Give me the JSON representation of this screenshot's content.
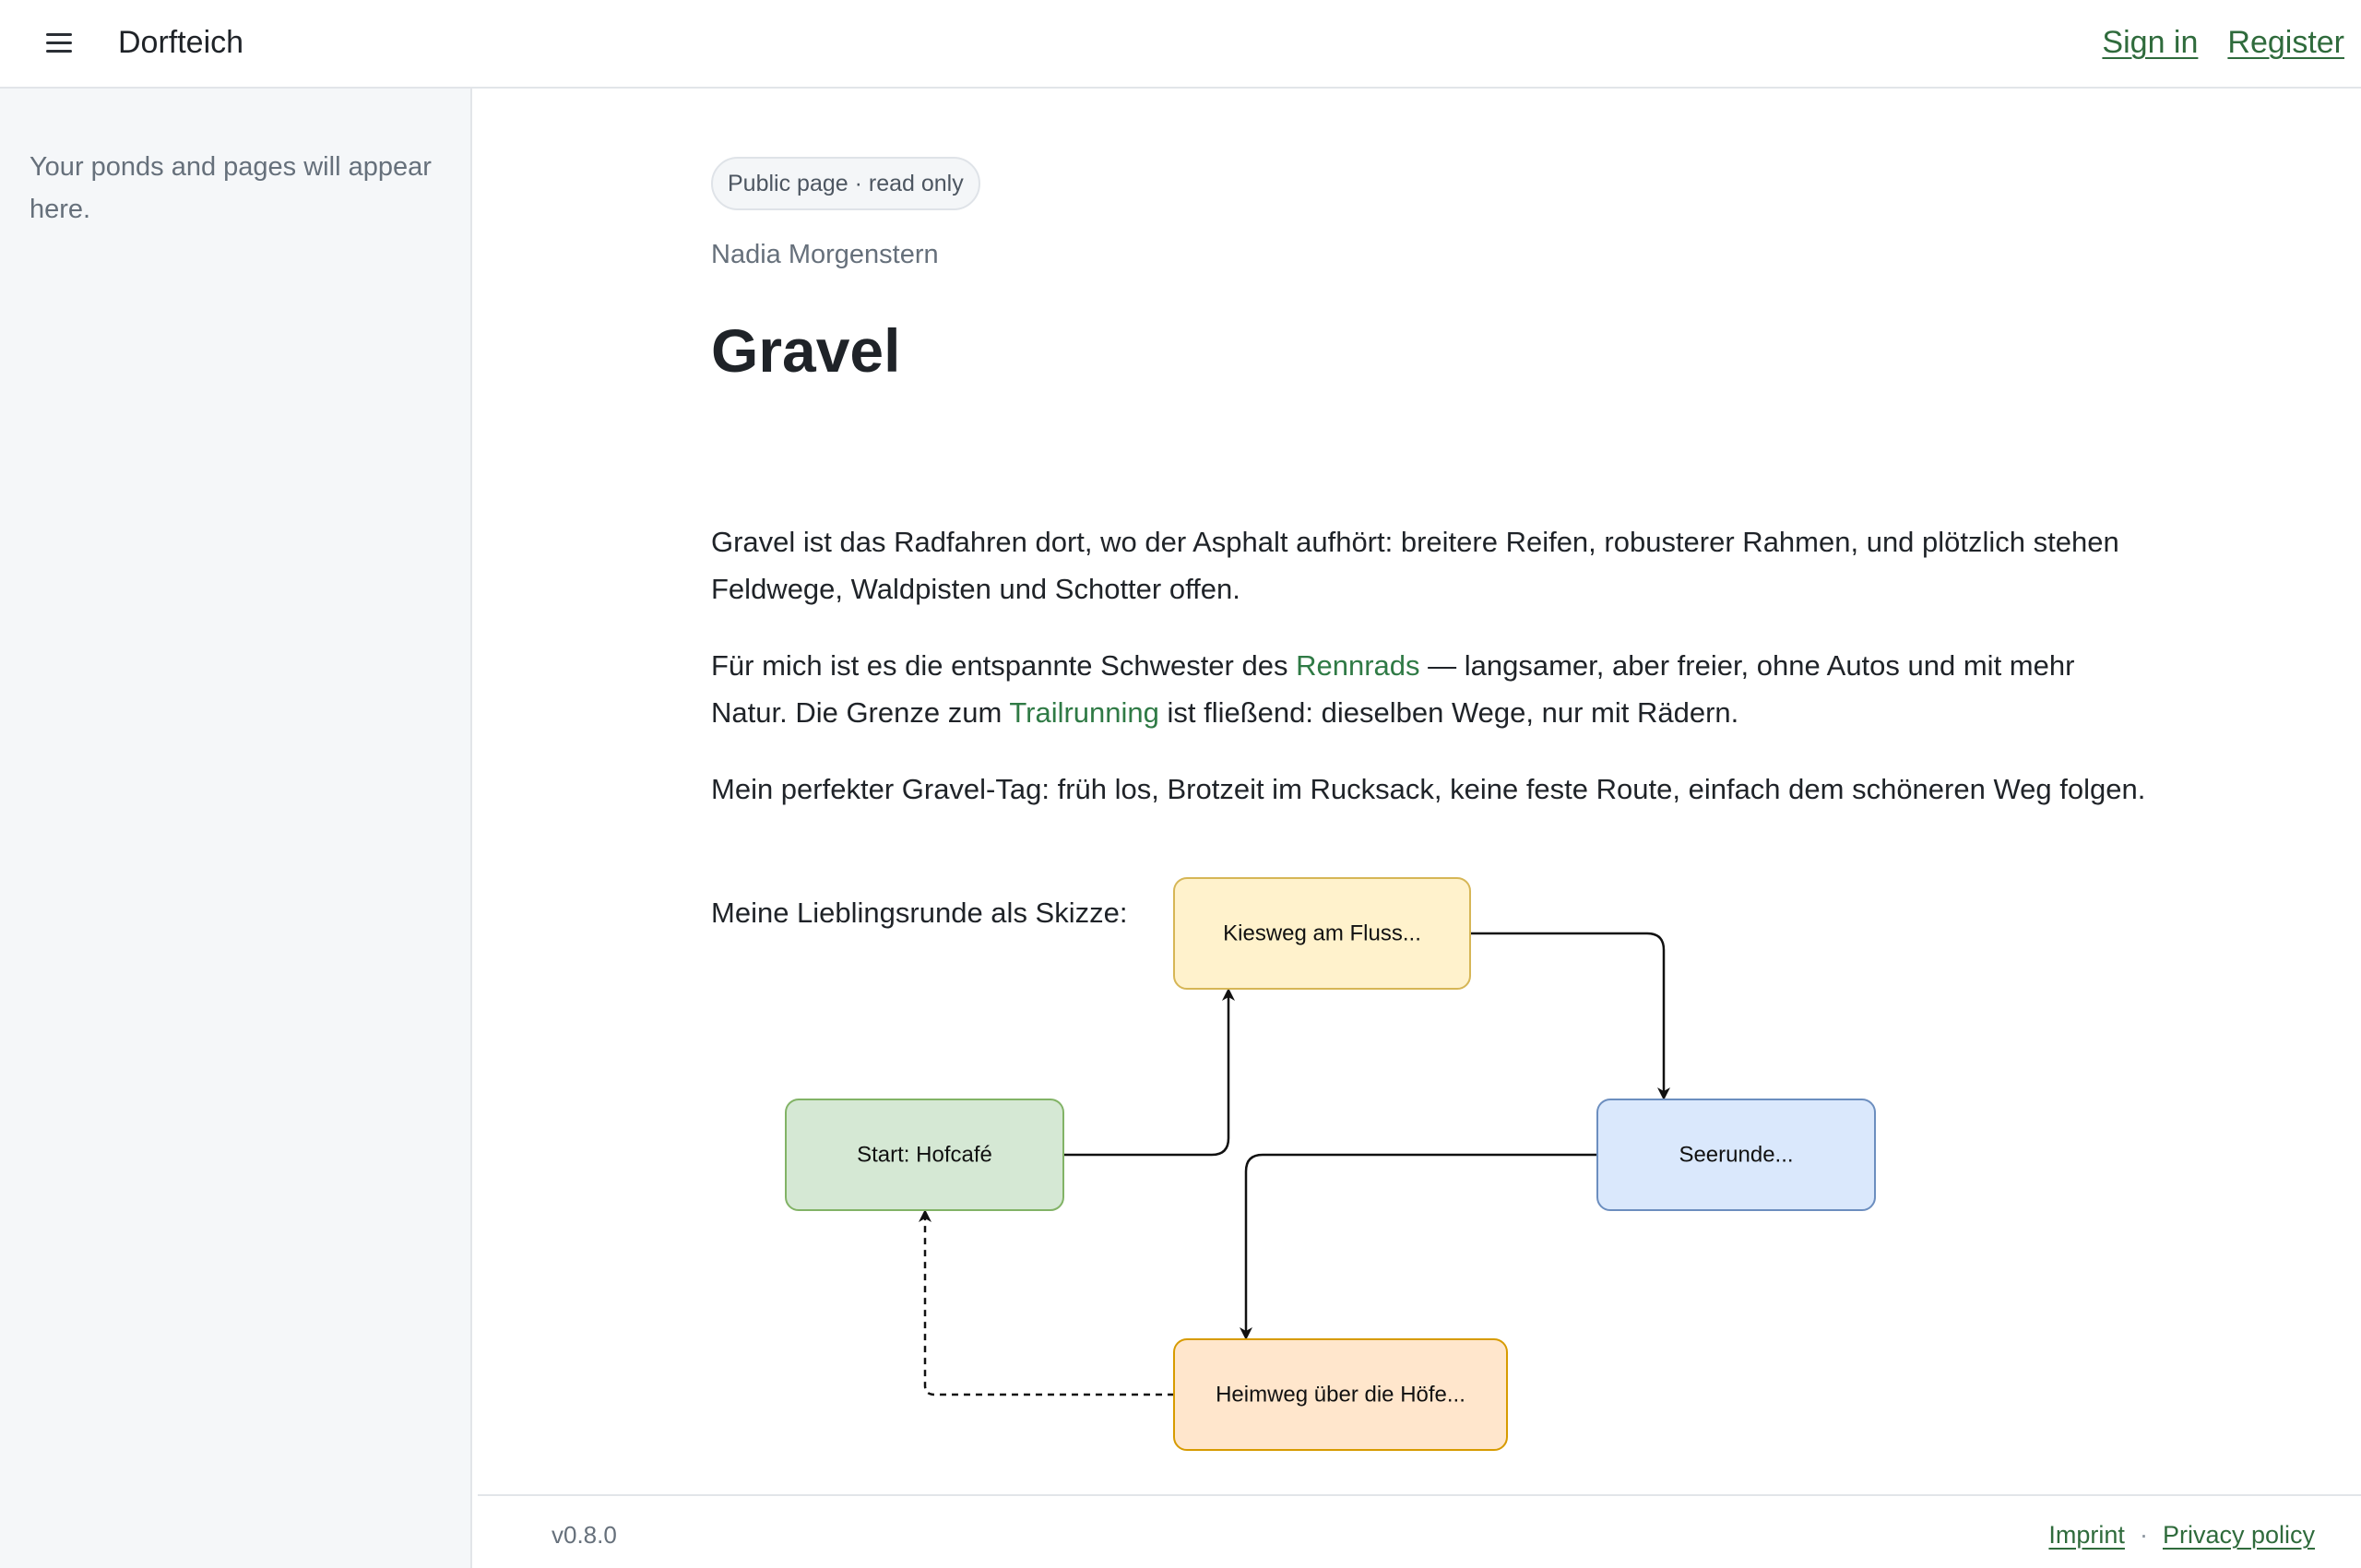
{
  "app": {
    "name": "Dorfteich",
    "menu_icon": "hamburger-menu-icon"
  },
  "header": {
    "sign_in_label": "Sign in",
    "register_label": "Register"
  },
  "sidebar": {
    "empty_text": "Your ponds and pages will appear here."
  },
  "page": {
    "badge": "Public page · read only",
    "author": "Nadia Morgenstern",
    "title": "Gravel",
    "paragraph_1": "Gravel ist das Radfahren dort, wo der Asphalt aufhört: breitere Reifen, robusterer Rahmen, und plötzlich stehen Feldwege, Waldpisten und Schotter offen.",
    "paragraph_2": {
      "before_link_1": "Für mich ist es die entspannte Schwester des ",
      "link_1": "Rennrads",
      "between_links": " — langsamer, aber freier, ohne Autos und mit mehr Natur. Die Grenze zum ",
      "link_2": "Trailrunning",
      "after_link_2": " ist fließend: dieselben Wege, nur mit Rädern."
    },
    "paragraph_3": "Mein perfekter Gravel-Tag: früh los, Brotzeit im Rucksack, keine feste Route, einfach dem schöneren Weg folgen.",
    "paragraph_4": "Meine Lieblingsrunde als Skizze:"
  },
  "diagram": {
    "nodes": {
      "start": {
        "label": "Start: Hofcafé",
        "fill": "#d5e8d4",
        "stroke": "#82b366"
      },
      "kiesweg": {
        "label": "Kiesweg am Fluss...",
        "fill": "#fff2cc",
        "stroke": "#d6b656"
      },
      "seerunde": {
        "label": "Seerunde...",
        "fill": "#dae8fc",
        "stroke": "#6c8ebf"
      },
      "heimweg": {
        "label": "Heimweg über die Höfe...",
        "fill": "#ffe6cc",
        "stroke": "#d79b00"
      }
    },
    "edges": [
      {
        "from": "start",
        "to": "kiesweg",
        "style": "solid"
      },
      {
        "from": "kiesweg",
        "to": "seerunde",
        "style": "solid"
      },
      {
        "from": "seerunde",
        "to": "heimweg",
        "style": "solid"
      },
      {
        "from": "heimweg",
        "to": "start",
        "style": "dashed"
      }
    ]
  },
  "footer": {
    "version": "v0.8.0",
    "imprint_label": "Imprint",
    "separator": "·",
    "privacy_label": "Privacy policy"
  },
  "colors": {
    "accent_link": "#2f6b3c",
    "inline_link": "#2f7a45",
    "sidebar_bg": "#f5f7f9"
  }
}
